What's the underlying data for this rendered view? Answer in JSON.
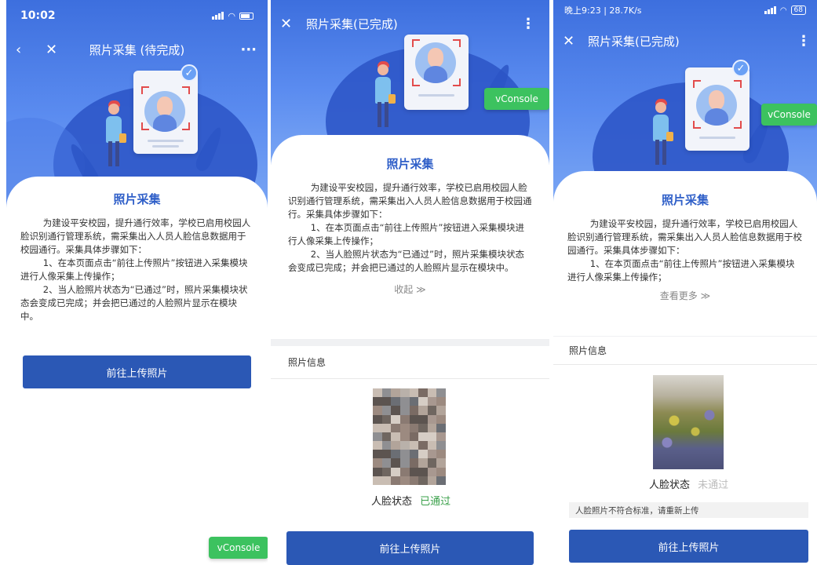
{
  "screens": [
    {
      "status_time": "10:02",
      "nav_title": "照片采集 (待完成)",
      "section_title": "照片采集",
      "paragraphs": [
        "为建设平安校园，提升通行效率，学校已启用校园人脸识别通行管理系统，需采集出入人员人脸信息数据用于校园通行。采集具体步骤如下：",
        "1、在本页面点击“前往上传照片”按钮进入采集模块进行人像采集上传操作；",
        "2、当人脸照片状态为“已通过”时，照片采集模块状态会变成已完成；并会把已通过的人脸照片显示在模块中。"
      ],
      "button_label": "前往上传照片",
      "vconsole_label": "vConsole"
    },
    {
      "nav_title": "照片采集(已完成)",
      "section_title": "照片采集",
      "paragraphs": [
        "为建设平安校园，提升通行效率，学校已启用校园人脸识别通行管理系统，需采集出入人员人脸信息数据用于校园通行。采集具体步骤如下：",
        "1、在本页面点击“前往上传照片”按钮进入采集模块进行人像采集上传操作；",
        "2、当人脸照片状态为“已通过”时，照片采集模块状态会变成已完成；并会把已通过的人脸照片显示在模块中。"
      ],
      "toggle_label": "收起 ≫",
      "info_label": "照片信息",
      "face_status_label": "人脸状态",
      "face_status_value": "已通过",
      "button_label": "前往上传照片",
      "vconsole_label": "vConsole"
    },
    {
      "status_left": "晚上9:23 | 28.7K/s",
      "battery": "68",
      "nav_title": "照片采集(已完成)",
      "section_title": "照片采集",
      "paragraphs": [
        "为建设平安校园，提升通行效率，学校已启用校园人脸识别通行管理系统，需采集出入人员人脸信息数据用于校园通行。采集具体步骤如下：",
        "1、在本页面点击“前往上传照片”按钮进入采集模块进行人像采集上传操作；"
      ],
      "toggle_label": "查看更多 ≫",
      "info_label": "照片信息",
      "face_status_label": "人脸状态",
      "face_status_value": "未通过",
      "notice": "人脸照片不符合标准，请重新上传",
      "button_label": "前往上传照片",
      "vconsole_label": "vConsole"
    }
  ],
  "colors": {
    "primary": "#2b58b5",
    "hero_blue": "#3d6fde",
    "title_blue": "#2f5fc8",
    "pass_green": "#3aa04a",
    "fail_gray": "#bcbcbc",
    "vconsole_green": "#3cc25f"
  },
  "icons": [
    "back-arrow-icon",
    "close-icon",
    "more-icon",
    "check-icon",
    "signal-icon",
    "wifi-icon",
    "battery-icon"
  ]
}
